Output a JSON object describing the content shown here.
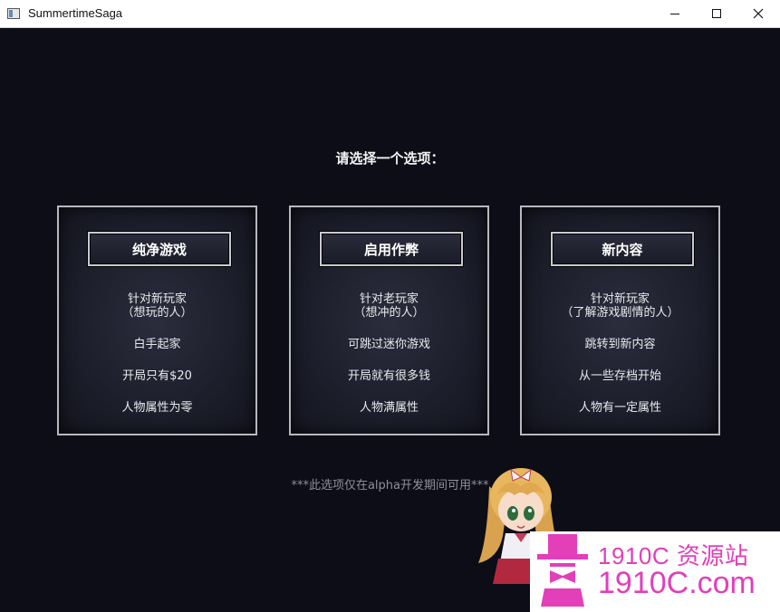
{
  "window": {
    "title": "SummertimeSaga",
    "controls": {
      "minimize": "minimize-icon",
      "maximize": "maximize-icon",
      "close": "close-icon"
    }
  },
  "menu": {
    "prompt": "请选择一个选项：",
    "options": [
      {
        "button": "纯净游戏",
        "lines": [
          "针对新玩家",
          "（想玩的人）",
          "白手起家",
          "开局只有$20",
          "人物属性为零"
        ]
      },
      {
        "button": "启用作弊",
        "lines": [
          "针对老玩家",
          "（想冲的人）",
          "可跳过迷你游戏",
          "开局就有很多钱",
          "人物满属性"
        ]
      },
      {
        "button": "新内容",
        "lines": [
          "针对新玩家",
          "（了解游戏剧情的人）",
          "跳转到新内容",
          "从一些存档开始",
          "人物有一定属性"
        ]
      }
    ],
    "footnote": "***此选项仅在alpha开发期间可用***"
  },
  "watermark": {
    "line1": "1910C 资源站",
    "line2": "1910C.com",
    "logo": "top-hat-bowtie-logo"
  },
  "colors": {
    "background": "#0c0d16",
    "card_border": "#b8b8be",
    "watermark": "#e23fb9"
  }
}
